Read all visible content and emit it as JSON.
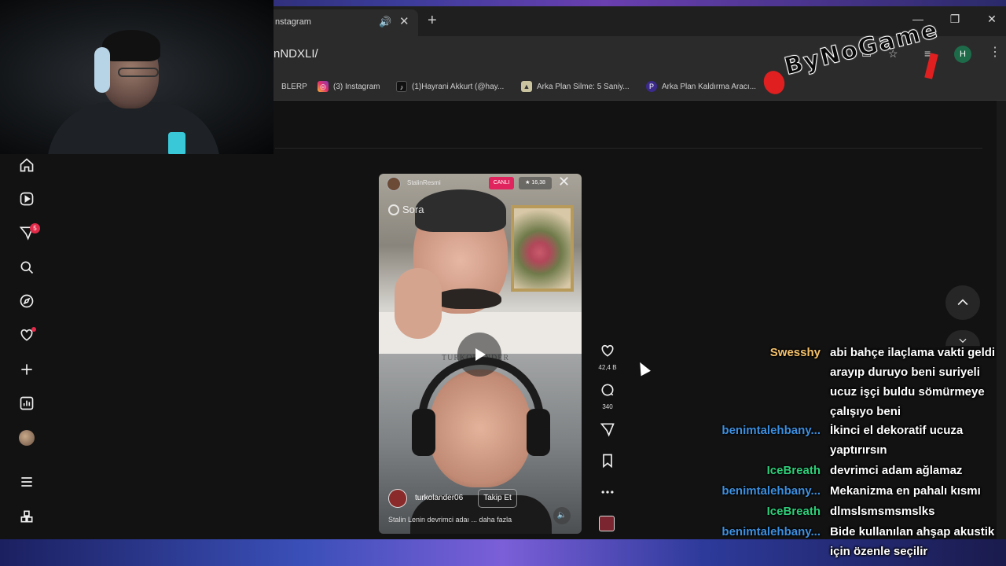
{
  "browser": {
    "tab_title": "nstagram",
    "url": "nNDXLI/",
    "profile_initial": "H",
    "bookmarks": [
      {
        "label": "BLERP",
        "icon": "blerp-icon"
      },
      {
        "label": "(3) Instagram",
        "icon": "instagram-icon"
      },
      {
        "label": "(1)Hayrani Akkurt (@hay...",
        "icon": "tiktok-icon"
      },
      {
        "label": "Arka Plan Silme: 5 Saniy...",
        "icon": "removebg-icon"
      },
      {
        "label": "Arka Plan Kaldırma Aracı...",
        "icon": "photoroom-icon"
      }
    ]
  },
  "sidebar": {
    "items": [
      {
        "name": "home-icon"
      },
      {
        "name": "reels-icon"
      },
      {
        "name": "messages-icon",
        "badge": "5"
      },
      {
        "name": "search-icon"
      },
      {
        "name": "explore-icon"
      },
      {
        "name": "notifications-icon"
      },
      {
        "name": "create-icon"
      },
      {
        "name": "dashboard-icon"
      },
      {
        "name": "profile-avatar"
      },
      {
        "name": "more-menu-icon"
      },
      {
        "name": "apps-icon"
      }
    ]
  },
  "reel": {
    "top_user": "StalinResmi",
    "live_label": "CANLI",
    "viewers": "★ 16,38",
    "effect_label": "Sora",
    "watermark": "TURKOLANDER",
    "author": "turkolander06",
    "follow_label": "Takip Et",
    "caption": "Stalin Lenin devrimci adaı ... daha fazla"
  },
  "actions": {
    "likes": "42,4 B",
    "comments": "340"
  },
  "overlay": {
    "logo_text": "ByNoGame"
  },
  "chat": [
    {
      "user": "Swesshy",
      "color": "#f5c26b",
      "lines": [
        "abi bahçe ilaçlama vakti geldi",
        "arayıp duruyo beni suriyeli",
        "ucuz işçi buldu sömürmeye",
        "çalışıyo beni"
      ]
    },
    {
      "user": "benimtalehbany...",
      "color": "#3d8fe0",
      "lines": [
        "İkinci el dekoratif ucuza",
        "yaptırırsın"
      ]
    },
    {
      "user": "IceBreath",
      "color": "#2ecf7a",
      "lines": [
        "devrimci adam ağlamaz"
      ]
    },
    {
      "user": "benimtalehbany...",
      "color": "#3d8fe0",
      "lines": [
        "Mekanizma en pahalı kısmı"
      ]
    },
    {
      "user": "IceBreath",
      "color": "#2ecf7a",
      "lines": [
        "dlmslsmsmsmslks"
      ]
    },
    {
      "user": "benimtalehbany...",
      "color": "#3d8fe0",
      "lines": [
        "Bide kullanılan ahşap akustik",
        "için özenle seçilir"
      ]
    }
  ]
}
